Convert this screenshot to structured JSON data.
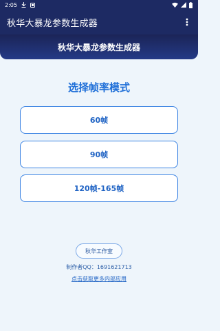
{
  "status_bar": {
    "time": "2:05",
    "icons": [
      "download-icon",
      "notification-icon",
      "wifi-icon",
      "signal-icon",
      "battery-icon"
    ]
  },
  "app_bar": {
    "title": "秋华大暴龙参数生成器",
    "menu_icon": "more-vert-icon"
  },
  "banner": {
    "title": "秋华大暴龙参数生成器"
  },
  "main": {
    "section_title": "选择帧率模式",
    "modes": [
      {
        "label": "60帧"
      },
      {
        "label": "90帧"
      },
      {
        "label": "120帧-165帧"
      }
    ]
  },
  "footer": {
    "studio_label": "秋华工作室",
    "author_label": "制作者QQ：",
    "author_qq": "1691621713",
    "more_link": "点击获取更多内部应用"
  },
  "colors": {
    "header_bg": "#1d2a63",
    "page_bg": "#eef5fb",
    "accent": "#1f6fd8",
    "button_border": "#3d84e3"
  }
}
